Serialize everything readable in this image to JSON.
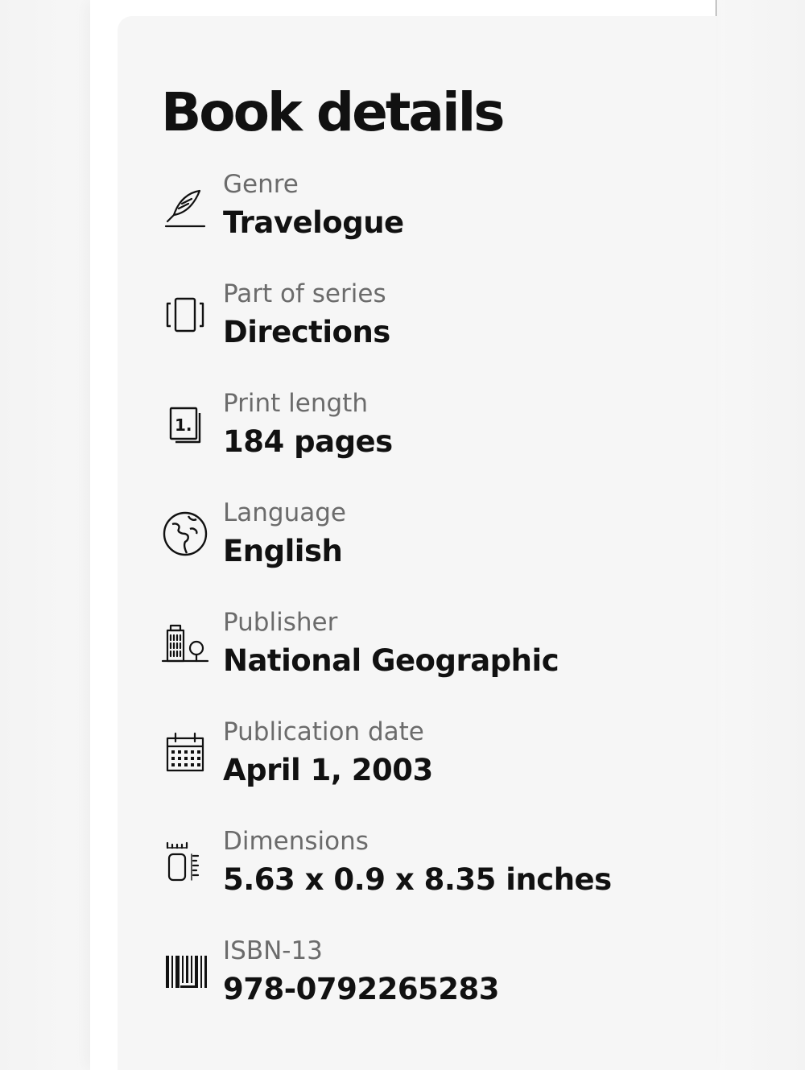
{
  "section": {
    "title": "Book details"
  },
  "details": [
    {
      "icon": "quill-icon",
      "label": "Genre",
      "value": "Travelogue"
    },
    {
      "icon": "series-icon",
      "label": "Part of series",
      "value": "Directions"
    },
    {
      "icon": "pages-icon",
      "label": "Print length",
      "value": "184 pages"
    },
    {
      "icon": "globe-icon",
      "label": "Language",
      "value": "English"
    },
    {
      "icon": "publisher-building-icon",
      "label": "Publisher",
      "value": "National Geographic"
    },
    {
      "icon": "calendar-icon",
      "label": "Publication date",
      "value": "April 1, 2003"
    },
    {
      "icon": "dimensions-icon",
      "label": "Dimensions",
      "value": "5.63 x 0.9 x 8.35 inches"
    },
    {
      "icon": "barcode-icon",
      "label": "ISBN-13",
      "value": "978-0792265283"
    }
  ]
}
